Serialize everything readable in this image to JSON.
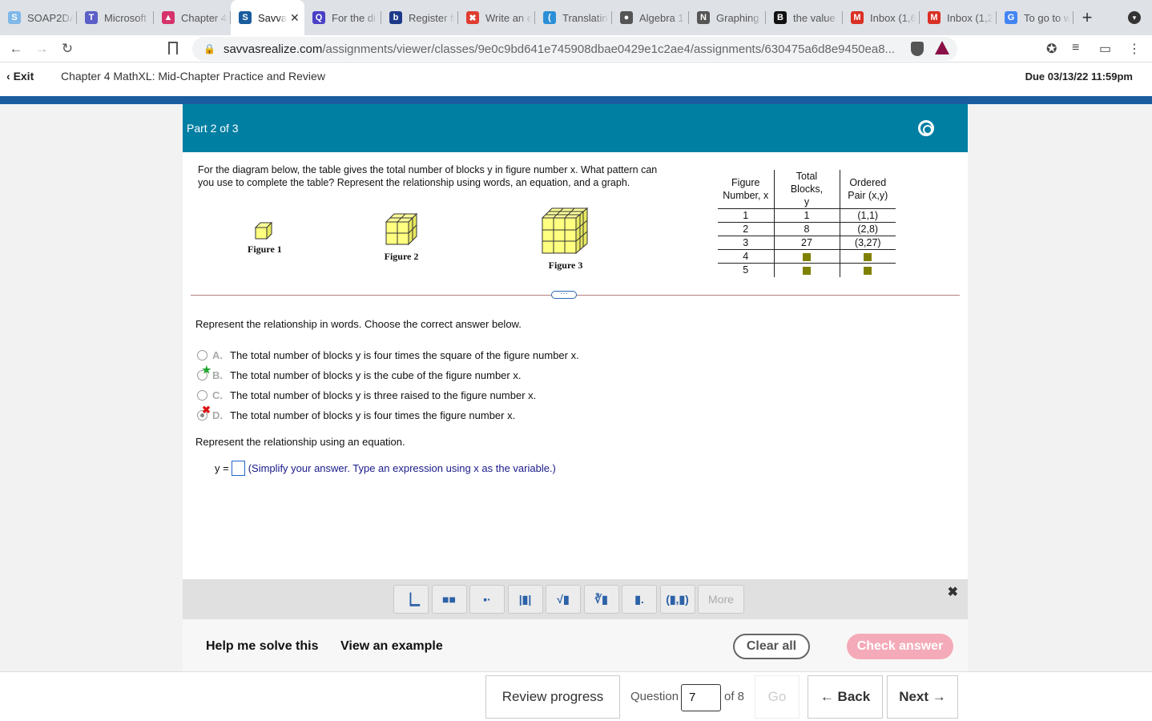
{
  "browser": {
    "tabs": [
      {
        "label": "SOAP2DA",
        "color": "#7fb8e8",
        "glyph": "S"
      },
      {
        "label": "Microsoft",
        "color": "#5b5fc7",
        "glyph": "T"
      },
      {
        "label": "Chapter 4",
        "color": "#d6336c",
        "glyph": "▲"
      },
      {
        "label": "Savvas",
        "color": "#1a5c9e",
        "glyph": "S",
        "active": true
      },
      {
        "label": "For the di",
        "color": "#4a3fc7",
        "glyph": "Q"
      },
      {
        "label": "Register fo",
        "color": "#1d3a8a",
        "glyph": "b"
      },
      {
        "label": "Write an e",
        "color": "#e03c31",
        "glyph": "✖"
      },
      {
        "label": "Translatin",
        "color": "#2a8fd6",
        "glyph": "("
      },
      {
        "label": "Algebra 1",
        "color": "#555555",
        "glyph": "●"
      },
      {
        "label": "Graphing",
        "color": "#555555",
        "glyph": "N"
      },
      {
        "label": "the value",
        "color": "#111111",
        "glyph": "B"
      },
      {
        "label": "Inbox (1,6",
        "color": "#d93025",
        "glyph": "M"
      },
      {
        "label": "Inbox (1,2",
        "color": "#d93025",
        "glyph": "M"
      },
      {
        "label": "To go to w",
        "color": "#4285f4",
        "glyph": "G"
      }
    ],
    "active_close": "✕",
    "new_tab": "+",
    "url_host": "savvasrealize.com",
    "url_path": "/assignments/viewer/classes/9e0c9bd641e745908dbae0429e1c2ae4/assignments/630475a6d8e9450ea8..."
  },
  "header": {
    "exit_label": "Exit",
    "title": "Chapter 4 MathXL: Mid-Chapter Practice and Review",
    "due": "Due 03/13/22 11:59pm"
  },
  "part": {
    "label": "Part 2 of 3"
  },
  "question": {
    "text": "For the diagram below, the table gives the total number of blocks y in figure number x. What pattern can you use to complete the table? Represent the relationship using words, an equation, and a graph.",
    "figures": [
      "Figure 1",
      "Figure 2",
      "Figure 3"
    ],
    "table": {
      "headers": [
        "Figure Number, x",
        "Total Blocks, y",
        "Ordered Pair (x,y)"
      ],
      "header_lines": [
        [
          "Figure",
          "Number, x"
        ],
        [
          "Total Blocks,",
          "y"
        ],
        [
          "Ordered",
          "Pair (x,y)"
        ]
      ],
      "rows": [
        [
          "1",
          "1",
          "(1,1)"
        ],
        [
          "2",
          "8",
          "(2,8)"
        ],
        [
          "3",
          "27",
          "(3,27)"
        ],
        [
          "4",
          "",
          ""
        ],
        [
          "5",
          "",
          ""
        ]
      ]
    }
  },
  "words_prompt": "Represent the relationship in words. Choose the correct answer below.",
  "options": [
    {
      "letter": "A.",
      "text": "The total number of blocks y is four times the square of the figure number x.",
      "state": "none"
    },
    {
      "letter": "B.",
      "text": "The total number of blocks y is the cube of the figure number x.",
      "state": "correct"
    },
    {
      "letter": "C.",
      "text": "The total number of blocks y is three raised to the figure number x.",
      "state": "none"
    },
    {
      "letter": "D.",
      "text": "The total number of blocks y is four times the figure number x.",
      "state": "incorrect"
    }
  ],
  "equation_prompt": "Represent the relationship using an equation.",
  "equation": {
    "prefix": "y =",
    "value": "",
    "hint": "(Simplify your answer. Type an expression using x as the variable.)"
  },
  "toolbar": {
    "buttons": [
      "▕▁",
      "■■",
      "▪·",
      "|▮|",
      "√▮",
      "∛▮",
      "▮.",
      "(▮,▮)"
    ],
    "more_label": "More",
    "close": "✖"
  },
  "actions": {
    "help": "Help me solve this",
    "example": "View an example",
    "clear": "Clear all",
    "check": "Check answer"
  },
  "nav": {
    "review": "Review progress",
    "question_label": "Question",
    "question_value": "7",
    "of_label": "of 8",
    "go": "Go",
    "back": "← Back",
    "next": "Next →"
  }
}
